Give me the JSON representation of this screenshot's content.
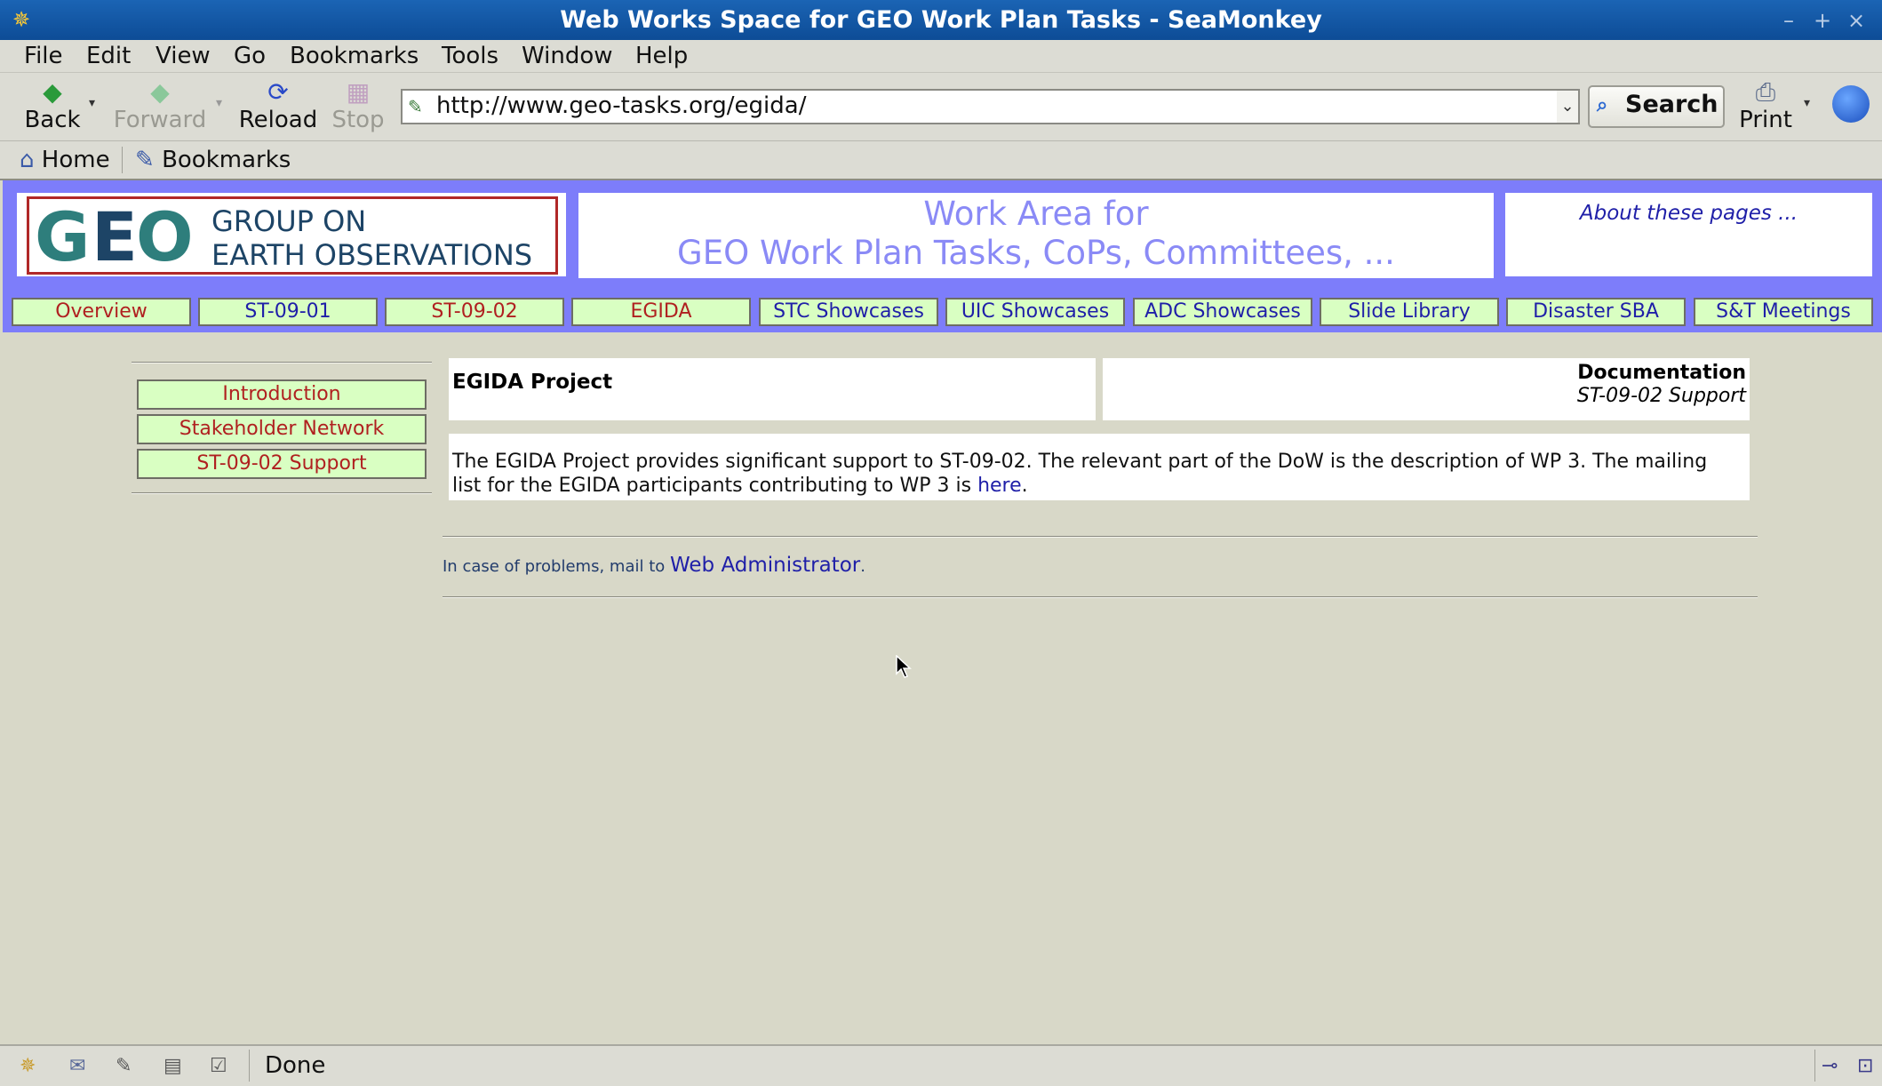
{
  "window": {
    "title": "Web Works Space for GEO Work Plan Tasks - SeaMonkey",
    "minimize": "–",
    "maximize": "+",
    "close": "×"
  },
  "menu": [
    "File",
    "Edit",
    "View",
    "Go",
    "Bookmarks",
    "Tools",
    "Window",
    "Help"
  ],
  "toolbar": {
    "back": "Back",
    "forward": "Forward",
    "reload": "Reload",
    "stop": "Stop",
    "url": "http://www.geo-tasks.org/egida/",
    "search": "Search",
    "print": "Print"
  },
  "personal_toolbar": {
    "home": "Home",
    "bookmarks": "Bookmarks"
  },
  "header": {
    "logo_line1": "GROUP ON",
    "logo_line2": "EARTH OBSERVATIONS",
    "work_line1": "Work Area for",
    "work_line2": "GEO Work Plan Tasks, CoPs, Committees, ...",
    "about": "About these pages ..."
  },
  "tabs": [
    {
      "label": "Overview",
      "color": "#b02020"
    },
    {
      "label": "ST-09-01",
      "color": "#1f1fa8"
    },
    {
      "label": "ST-09-02",
      "color": "#b02020"
    },
    {
      "label": "EGIDA",
      "color": "#b02020"
    },
    {
      "label": "STC Showcases",
      "color": "#1f1fa8"
    },
    {
      "label": "UIC Showcases",
      "color": "#1f1fa8"
    },
    {
      "label": "ADC Showcases",
      "color": "#1f1fa8"
    },
    {
      "label": "Slide Library",
      "color": "#1f1fa8"
    },
    {
      "label": "Disaster SBA",
      "color": "#1f1fa8"
    },
    {
      "label": "S&T Meetings",
      "color": "#1f1fa8"
    }
  ],
  "left_nav": [
    "Introduction",
    "Stakeholder Network",
    "ST-09-02 Support"
  ],
  "content": {
    "title": "EGIDA Project",
    "doc_label": "Documentation",
    "doc_sub": "ST-09-02 Support",
    "body_text": "The EGIDA Project provides significant support to ST-09-02. The relevant part of the DoW is the description of WP 3. The mailing list for the EGIDA participants contributing to WP 3 is ",
    "body_link": "here",
    "body_end": ".",
    "mail_text": "In case of problems, mail to ",
    "mail_link": "Web Administrator",
    "mail_end": "."
  },
  "status": {
    "text": "Done"
  }
}
